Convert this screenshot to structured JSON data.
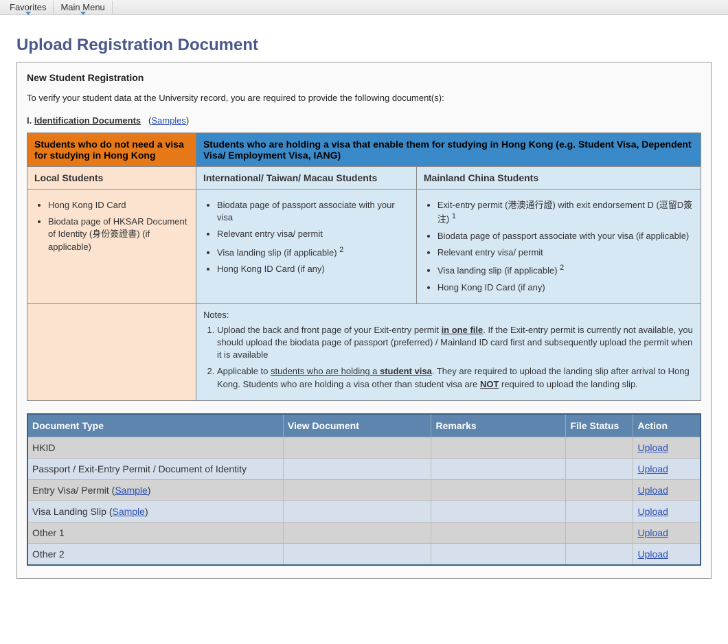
{
  "menubar": {
    "favorites": "Favorites",
    "mainmenu": "Main Menu"
  },
  "page_title": "Upload Registration Document",
  "panel": {
    "section_title": "New Student Registration",
    "lead_text": "To verify your student data at the University record, you are required to provide the following document(s):",
    "subhead_roman": "I.",
    "subhead_label": "Identification Documents",
    "samples_label": "Samples",
    "header_no_visa": "Students who do not need a visa for studying in Hong Kong",
    "header_visa": "Students who are holding a visa that enable them for studying in Hong Kong (e.g. Student Visa, Dependent Visa/ Employment Visa, IANG)",
    "col_local": "Local Students",
    "col_intl": "International/ Taiwan/ Macau Students",
    "col_mainland": "Mainland China Students",
    "local_items": [
      "Hong Kong ID Card",
      "Biodata page of HKSAR Document of Identity (身份簽證書) (if applicable)"
    ],
    "intl_items": [
      "Biodata page of passport associate with your visa",
      "Relevant entry visa/ permit",
      "Visa landing slip (if applicable)",
      "Hong Kong ID Card (if any)"
    ],
    "mainland_items": [
      "Exit-entry permit (港澳通行證) with exit endorsement D (逗留D簽注)",
      "Biodata page of passport associate with your visa (if applicable)",
      "Relevant entry visa/ permit",
      "Visa landing slip (if applicable)",
      "Hong Kong ID Card (if any)"
    ],
    "notes_label": "Notes:",
    "note1_pre": "Upload the back and front page of your Exit-entry permit ",
    "note1_emph": "in one file",
    "note1_post": ". If the Exit-entry permit is currently not available, you should upload the biodata page of passport (preferred) / Mainland ID card first and subsequently upload the permit when it is available",
    "note2_pre": "Applicable to ",
    "note2_u1": "students who are holding a ",
    "note2_u2": "student visa",
    "note2_mid": ". They are required to upload the landing slip after arrival to Hong Kong. Students who are holding a visa other than student visa are ",
    "note2_not": "NOT",
    "note2_post": " required to upload the landing slip."
  },
  "doc_table": {
    "headers": {
      "doc_type": "Document Type",
      "view_doc": "View Document",
      "remarks": "Remarks",
      "file_status": "File Status",
      "action": "Action"
    },
    "rows": [
      {
        "label": "HKID",
        "has_sample": false
      },
      {
        "label": "Passport / Exit-Entry Permit / Document of Identity",
        "has_sample": false
      },
      {
        "label_pre": "Entry Visa/ Permit (",
        "sample": "Sample",
        "label_post": ")",
        "has_sample": true
      },
      {
        "label_pre": "Visa Landing Slip (",
        "sample": "Sample",
        "label_post": ")",
        "has_sample": true
      },
      {
        "label": "Other 1",
        "has_sample": false
      },
      {
        "label": "Other 2",
        "has_sample": false
      }
    ],
    "upload_label": "Upload"
  }
}
